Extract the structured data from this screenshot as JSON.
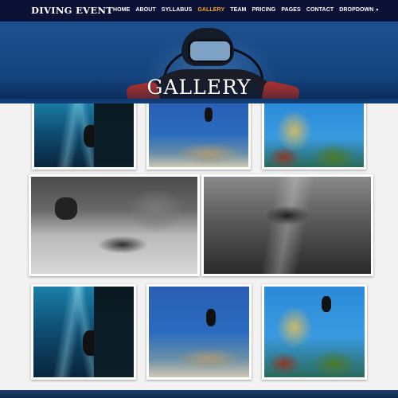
{
  "brand": "DIVING EVENT",
  "nav": {
    "items": [
      {
        "label": "HOME",
        "active": false
      },
      {
        "label": "ABOUT",
        "active": false
      },
      {
        "label": "SYLLABUS",
        "active": false
      },
      {
        "label": "GALLERY",
        "active": true
      },
      {
        "label": "TEAM",
        "active": false
      },
      {
        "label": "PRICING",
        "active": false
      },
      {
        "label": "PAGES",
        "active": false
      },
      {
        "label": "CONTACT",
        "active": false
      },
      {
        "label": "DROPDOWN",
        "active": false
      }
    ],
    "active_color": "#f5a623",
    "caret_icon": "caret-down-icon"
  },
  "hero": {
    "title": "GALLERY"
  },
  "gallery": {
    "photos": [
      {
        "name": "cave-divers-light-rays"
      },
      {
        "name": "diver-over-reef"
      },
      {
        "name": "diver-over-coral"
      },
      {
        "name": "sea-turtle-bw"
      },
      {
        "name": "diver-with-camera-bw"
      },
      {
        "name": "cave-divers-light-rays"
      },
      {
        "name": "diver-over-reef"
      },
      {
        "name": "diver-over-coral"
      }
    ]
  },
  "colors": {
    "navbar_bg": "#0c1236",
    "page_bg": "#f2f2f2"
  }
}
